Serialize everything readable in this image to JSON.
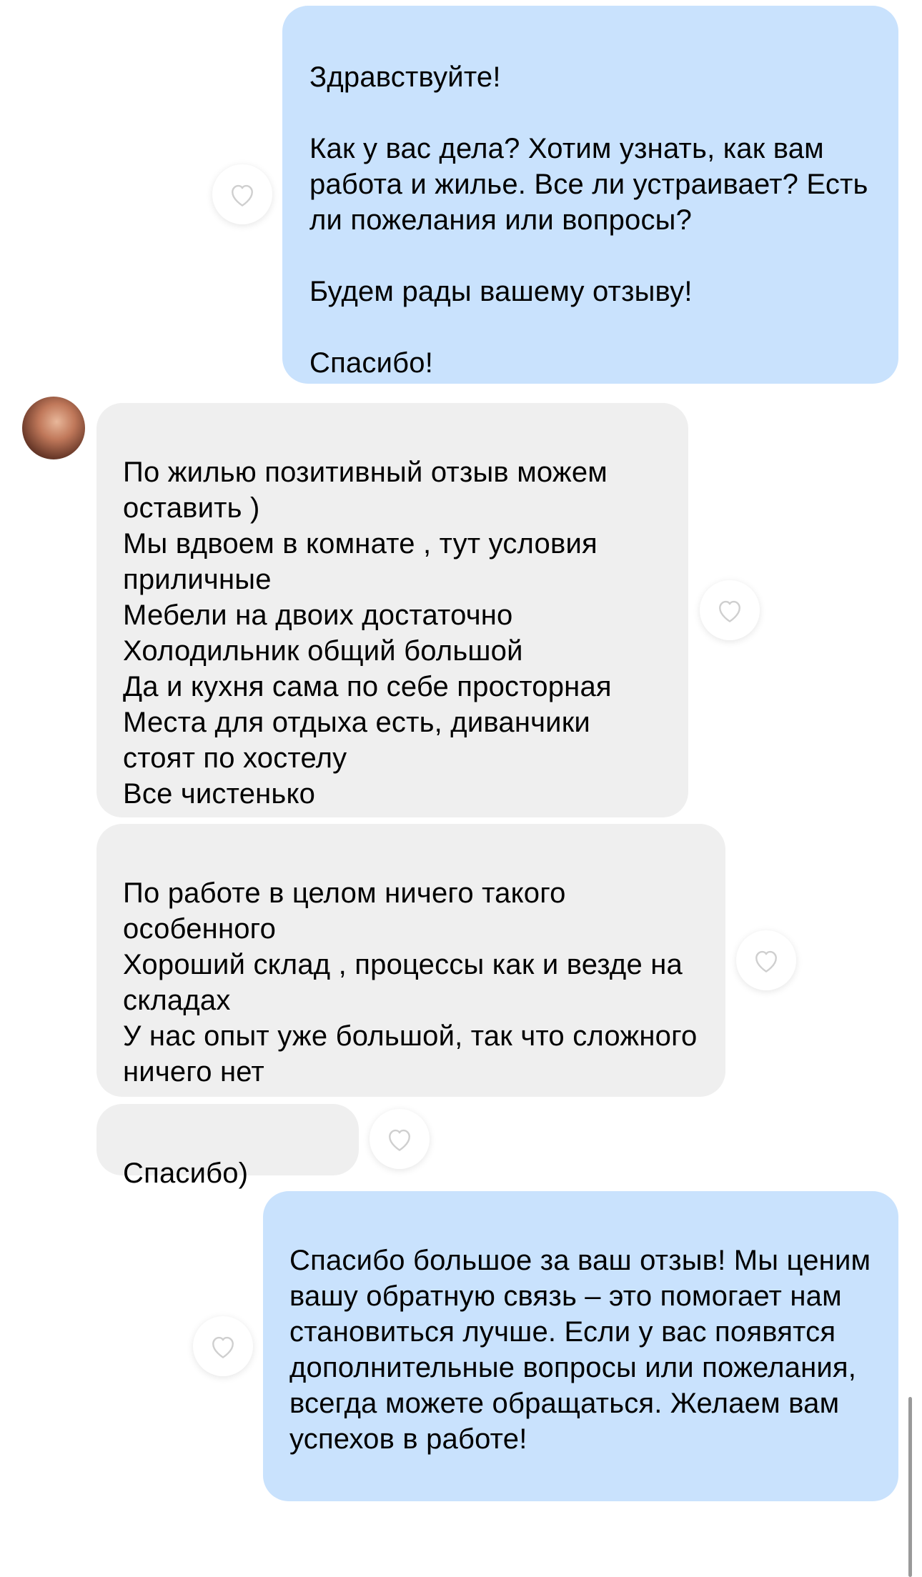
{
  "colors": {
    "outgoing_bubble": "#c9e2fd",
    "incoming_bubble": "#efefef",
    "text": "#000000"
  },
  "messages": [
    {
      "direction": "outgoing",
      "text": "Здравствуйте!\n\nКак у вас дела? Хотим узнать, как вам работа и жилье. Все ли устраивает? Есть ли пожелания или вопросы?\n\nБудем рады вашему отзыву!\n\nСпасибо!",
      "like_icon": "heart-outline-icon"
    },
    {
      "direction": "incoming",
      "text": "По жилью позитивный отзыв можем оставить )\nМы вдвоем в комнате , тут условия приличные\nМебели на двоих достаточно\nХолодильник общий большой\nДа и кухня сама по себе просторная\nМеста для отдыха есть, диванчики стоят по хостелу\nВсе чистенько",
      "like_icon": "heart-outline-icon"
    },
    {
      "direction": "incoming",
      "text": "По работе в целом ничего такого особенного\nХороший склад , процессы как и везде на складах\nУ нас опыт уже большой, так что сложного ничего нет",
      "like_icon": "heart-outline-icon"
    },
    {
      "direction": "incoming",
      "text": "Спасибо)",
      "like_icon": "heart-outline-icon"
    },
    {
      "direction": "outgoing",
      "text": "Спасибо большое за ваш отзыв! Мы ценим вашу обратную связь – это помогает нам становиться лучше. Если у вас появятся дополнительные вопросы или пожелания, всегда можете обращаться. Желаем вам успехов в работе!",
      "like_icon": "heart-outline-icon"
    }
  ]
}
